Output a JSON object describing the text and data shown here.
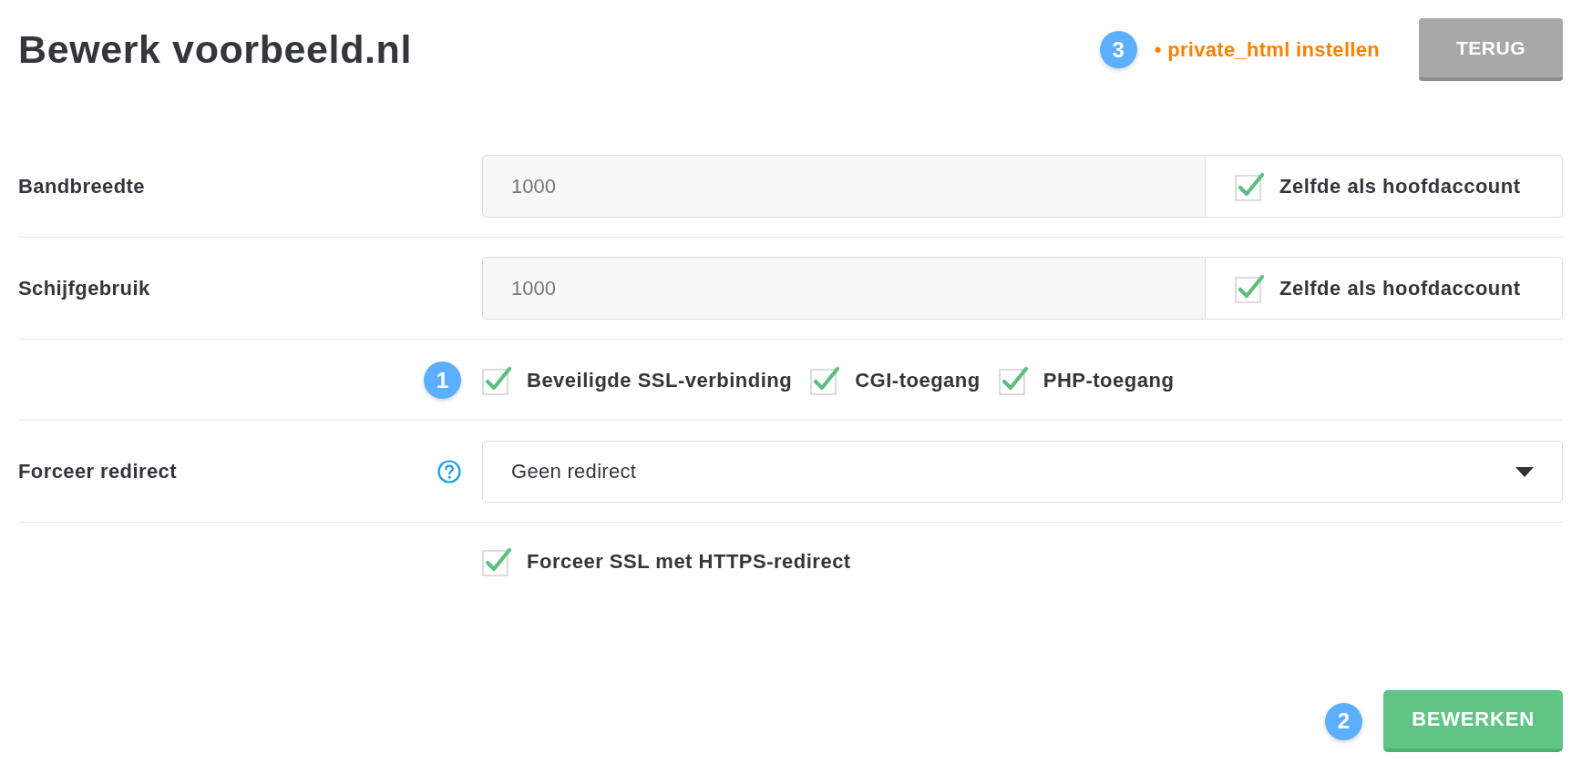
{
  "page": {
    "title": "Bewerk voorbeeld.nl"
  },
  "header": {
    "step_badge": "3",
    "link": "• private_html instellen",
    "back_button": "TERUG"
  },
  "limits": [
    {
      "label": "Bandbreedte",
      "value": "1000",
      "same_as_main": {
        "label": "Zelfde als hoofdaccount",
        "checked": true
      }
    },
    {
      "label": "Schijfgebruik",
      "value": "1000",
      "same_as_main": {
        "label": "Zelfde als hoofdaccount",
        "checked": true
      }
    }
  ],
  "features": {
    "step_badge": "1",
    "options": [
      {
        "label": "Beveiligde SSL-verbinding",
        "checked": true
      },
      {
        "label": "CGI-toegang",
        "checked": true
      },
      {
        "label": "PHP-toegang",
        "checked": true
      }
    ]
  },
  "redirect": {
    "label": "Forceer redirect",
    "value": "Geen redirect"
  },
  "force_ssl": {
    "label": "Forceer SSL met HTTPS-redirect",
    "checked": true
  },
  "submit": {
    "step_badge": "2",
    "label": "BEWERKEN"
  }
}
